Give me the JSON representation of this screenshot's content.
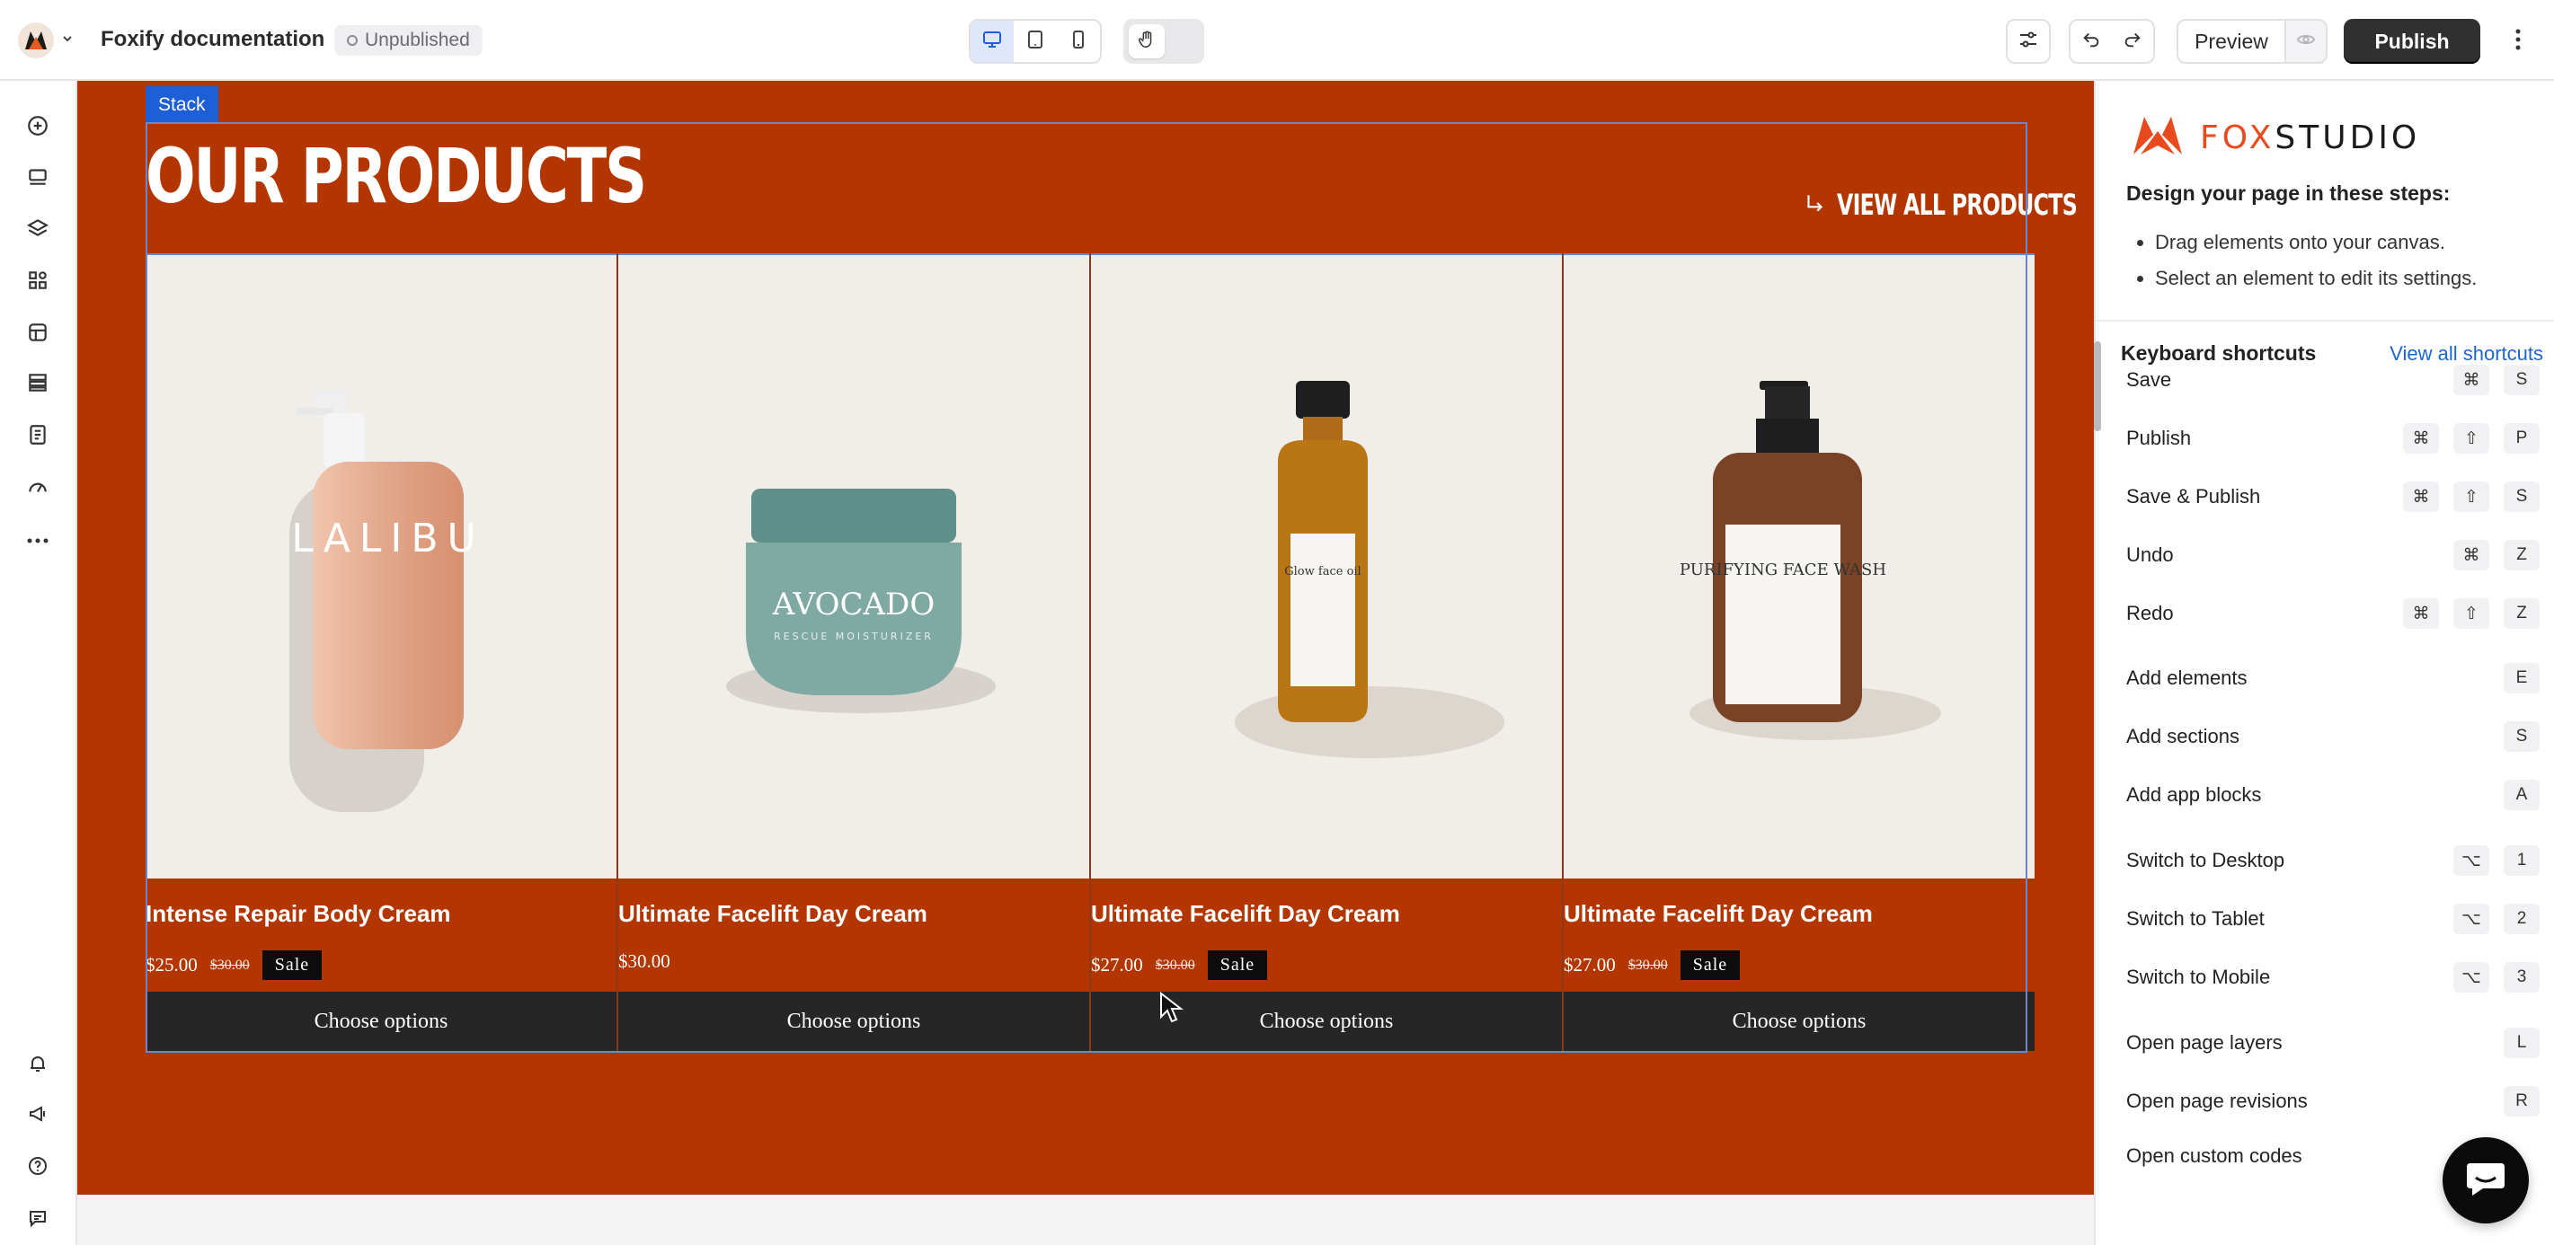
{
  "topbar": {
    "project_name": "Foxify documentation",
    "status": "Unpublished",
    "preview_label": "Preview",
    "publish_label": "Publish",
    "icons": [
      "app-logo-icon",
      "chevron-down-icon",
      "desktop-icon",
      "tablet-icon",
      "mobile-icon",
      "hand-icon",
      "settings-sliders-icon",
      "undo-icon",
      "redo-icon",
      "eye-icon",
      "more-vertical-icon"
    ]
  },
  "leftrail": {
    "icons": [
      "add-icon",
      "sections-icon",
      "layers-icon",
      "apps-icon",
      "templates-icon",
      "stack-icon",
      "pages-icon",
      "speed-icon",
      "more-icon",
      "notification-bell-icon",
      "announcement-icon",
      "help-icon",
      "chat-icon"
    ]
  },
  "canvas": {
    "stack_label": "Stack",
    "heading": "OUR PRODUCTS",
    "view_all": "VIEW ALL PRODUCTS",
    "section_color": "#b33500",
    "products": [
      {
        "title": "Intense Repair Body Cream",
        "price": "$25.00",
        "compare_price": "$30.00",
        "badge": "Sale",
        "button": "Choose options",
        "image": "malibu-lotion-bottle",
        "label": "LALIBU"
      },
      {
        "title": "Ultimate Facelift Day Cream",
        "price": "$30.00",
        "compare_price": "",
        "badge": "",
        "button": "Choose options",
        "image": "avocado-jar",
        "label": "AVOCADO",
        "sublabel": "RESCUE MOISTURIZER"
      },
      {
        "title": "Ultimate Facelift Day Cream",
        "price": "$27.00",
        "compare_price": "$30.00",
        "badge": "Sale",
        "button": "Choose options",
        "image": "glow-face-oil-bottle",
        "label": "Glow face oil"
      },
      {
        "title": "Ultimate Facelift Day Cream",
        "price": "$27.00",
        "compare_price": "$30.00",
        "badge": "Sale",
        "button": "Choose options",
        "image": "face-wash-pump-bottle",
        "label": "PURIFYING FACE WASH"
      }
    ]
  },
  "rightpanel": {
    "brand": {
      "fox": "FOX",
      "studio": "STUDIO"
    },
    "steps_title": "Design your page in these steps:",
    "steps": [
      "Drag elements onto your canvas.",
      "Select an element to edit its settings."
    ],
    "shortcuts_title": "Keyboard shortcuts",
    "shortcuts_link": "View all shortcuts",
    "shortcuts": [
      {
        "label": "Save",
        "keys": [
          "⌘",
          "S"
        ]
      },
      {
        "label": "Publish",
        "keys": [
          "⌘",
          "⇧",
          "P"
        ]
      },
      {
        "label": "Save & Publish",
        "keys": [
          "⌘",
          "⇧",
          "S"
        ]
      },
      {
        "label": "Undo",
        "keys": [
          "⌘",
          "Z"
        ]
      },
      {
        "label": "Redo",
        "keys": [
          "⌘",
          "⇧",
          "Z"
        ]
      },
      {
        "label": "Add elements",
        "keys": [
          "E"
        ]
      },
      {
        "label": "Add sections",
        "keys": [
          "S"
        ]
      },
      {
        "label": "Add app blocks",
        "keys": [
          "A"
        ]
      },
      {
        "label": "Switch to Desktop",
        "keys": [
          "⌥",
          "1"
        ]
      },
      {
        "label": "Switch to Tablet",
        "keys": [
          "⌥",
          "2"
        ]
      },
      {
        "label": "Switch to Mobile",
        "keys": [
          "⌥",
          "3"
        ]
      },
      {
        "label": "Open page layers",
        "keys": [
          "L"
        ]
      },
      {
        "label": "Open page revisions",
        "keys": [
          "R"
        ]
      },
      {
        "label": "Open custom codes",
        "keys": []
      }
    ]
  }
}
